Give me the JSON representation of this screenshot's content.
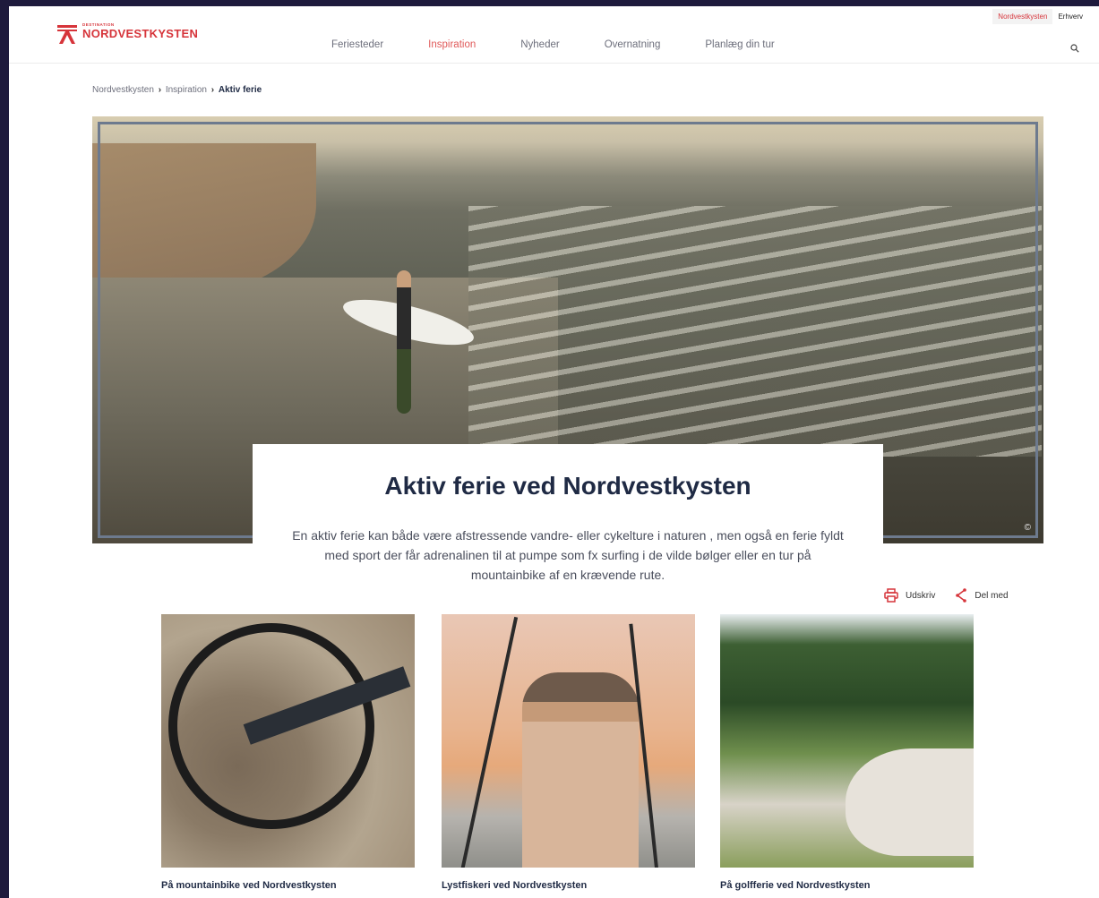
{
  "header": {
    "logo_small": "DESTINATION",
    "logo_big": "NORDVESTKYSTEN",
    "nav": [
      {
        "label": "Feriesteder",
        "active": false
      },
      {
        "label": "Inspiration",
        "active": true
      },
      {
        "label": "Nyheder",
        "active": false
      },
      {
        "label": "Overnatning",
        "active": false
      },
      {
        "label": "Planlæg din tur",
        "active": false
      }
    ],
    "toplinks": [
      "Nordvestkysten",
      "Erhverv"
    ],
    "search_icon": "search-icon"
  },
  "breadcrumb": {
    "items": [
      "Nordvestkysten",
      "Inspiration"
    ],
    "current": "Aktiv ferie",
    "separator": "›"
  },
  "hero": {
    "copyright_glyph": "©"
  },
  "intro": {
    "title": "Aktiv ferie ved Nordvestkysten",
    "text": "En aktiv ferie kan både være afstressende vandre- eller cykelture i naturen , men også en ferie fyldt med sport der får adrenalinen til at pumpe som fx surfing i de vilde bølger eller en tur på mountainbike af en krævende rute."
  },
  "actions": {
    "print_label": "Udskriv",
    "share_label": "Del med",
    "print_icon": "printer-icon",
    "share_icon": "share-icon"
  },
  "tiles": [
    {
      "title": "På mountainbike ved Nordvestkysten"
    },
    {
      "title": "Lystfiskeri ved Nordvestkysten"
    },
    {
      "title": "På golfferie ved Nordvestkysten"
    }
  ],
  "colors": {
    "brand": "#d6343a",
    "nav_active": "#e05a5a",
    "heading": "#1f2a44",
    "background": "#1e1a3c"
  }
}
